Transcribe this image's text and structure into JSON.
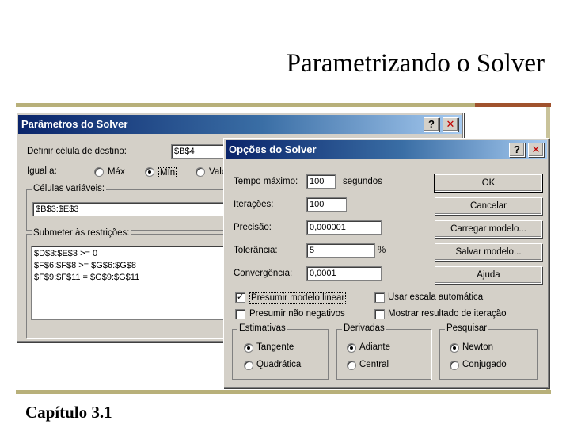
{
  "slide": {
    "title": "Parametrizando o Solver",
    "chapter": "Capítulo 3.1"
  },
  "solver_params": {
    "title": "Parâmetros do Solver",
    "help_glyph": "?",
    "close_glyph": "✕",
    "target_label": "Definir célula de destino:",
    "target_value": "$B$4",
    "equal_label": "Igual a:",
    "max_label": "Máx",
    "min_label": "Mín",
    "value_label": "Valo",
    "selected_goal": "Mín",
    "changing_label": "Células variáveis:",
    "changing_value": "$B$3:$E$3",
    "constraints_label": "Submeter às restrições:",
    "constraints": [
      "$D$3:$E$3 >= 0",
      "$F$6:$F$8 >= $G$6:$G$8",
      "$F$9:$F$11 = $G$9:$G$11"
    ]
  },
  "solver_options": {
    "title": "Opções do Solver",
    "help_glyph": "?",
    "close_glyph": "✕",
    "max_time_label": "Tempo máximo:",
    "max_time_value": "100",
    "max_time_unit": "segundos",
    "iterations_label": "Iterações:",
    "iterations_value": "100",
    "precision_label": "Precisão:",
    "precision_value": "0,000001",
    "tolerance_label": "Tolerância:",
    "tolerance_value": "5",
    "tolerance_unit": "%",
    "convergence_label": "Convergência:",
    "convergence_value": "0,0001",
    "buttons": {
      "ok": "OK",
      "cancel": "Cancelar",
      "load": "Carregar modelo...",
      "save": "Salvar modelo...",
      "help": "Ajuda"
    },
    "checkboxes": {
      "linear_model": "Presumir modelo linear",
      "linear_model_checked": true,
      "auto_scaling": "Usar escala automática",
      "auto_scaling_checked": false,
      "non_negative": "Presumir não negativos",
      "non_negative_checked": false,
      "show_iterations": "Mostrar resultado de iteração",
      "show_iterations_checked": false,
      "check_glyph": "✓"
    },
    "estimates": {
      "label": "Estimativas",
      "options": [
        "Tangente",
        "Quadrática"
      ],
      "selected": "Tangente"
    },
    "derivatives": {
      "label": "Derivadas",
      "options": [
        "Adiante",
        "Central"
      ],
      "selected": "Adiante"
    },
    "search": {
      "label": "Pesquisar",
      "options": [
        "Newton",
        "Conjugado"
      ],
      "selected": "Newton"
    }
  }
}
